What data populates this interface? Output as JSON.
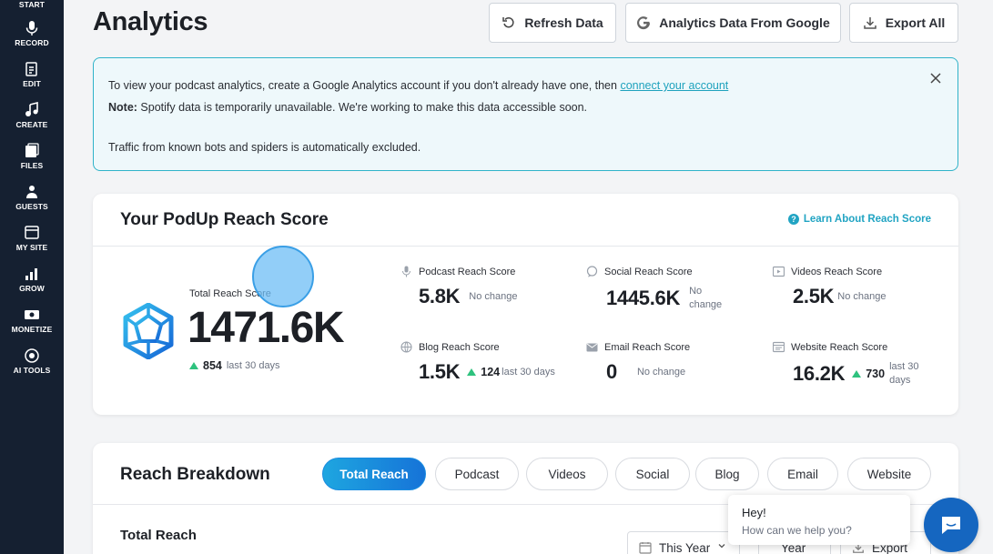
{
  "sidebar": {
    "items": [
      {
        "label": "START",
        "icon": "start-icon"
      },
      {
        "label": "RECORD",
        "icon": "mic-icon"
      },
      {
        "label": "EDIT",
        "icon": "edit-icon"
      },
      {
        "label": "CREATE",
        "icon": "music-note-icon"
      },
      {
        "label": "FILES",
        "icon": "files-icon"
      },
      {
        "label": "GUESTS",
        "icon": "guests-icon"
      },
      {
        "label": "MY SITE",
        "icon": "site-icon"
      },
      {
        "label": "GROW",
        "icon": "bar-chart-icon"
      },
      {
        "label": "MONETIZE",
        "icon": "monetize-icon"
      },
      {
        "label": "AI TOOLS",
        "icon": "ai-tools-icon"
      }
    ]
  },
  "header": {
    "title": "Analytics",
    "refresh_label": "Refresh Data",
    "google_label": "Analytics Data From Google",
    "export_label": "Export All"
  },
  "alert": {
    "line1_prefix": "To view your podcast analytics, create a Google Analytics account if you don't already have one, then ",
    "line1_link": "connect your account",
    "note_label": "Note:",
    "note_text": " Spotify data is temporarily unavailable. We're working to make this data accessible soon.",
    "line3": "Traffic from known bots and spiders is automatically excluded."
  },
  "reach_score": {
    "title": "Your PodUp Reach Score",
    "learn_link": "Learn About Reach Score",
    "total": {
      "label": "Total Reach Score",
      "value": "1471.6K",
      "delta": "854",
      "period": "last 30 days"
    },
    "metrics": [
      {
        "label": "Podcast Reach Score",
        "value": "5.8K",
        "note": "No change",
        "icon": "mic-icon"
      },
      {
        "label": "Social Reach Score",
        "value": "1445.6K",
        "note": "No change",
        "icon": "chat-icon"
      },
      {
        "label": "Videos Reach Score",
        "value": "2.5K",
        "note": "No change",
        "icon": "video-icon"
      },
      {
        "label": "Blog Reach Score",
        "value": "1.5K",
        "delta": "124",
        "note": "last 30 days",
        "icon": "globe-icon"
      },
      {
        "label": "Email Reach Score",
        "value": "0",
        "note": "No change",
        "icon": "email-icon"
      },
      {
        "label": "Website Reach Score",
        "value": "16.2K",
        "delta": "730",
        "note": "last 30 days",
        "icon": "website-icon"
      }
    ]
  },
  "breakdown": {
    "title": "Reach Breakdown",
    "tabs": [
      "Total Reach",
      "Podcast",
      "Videos",
      "Social",
      "Blog",
      "Email",
      "Website"
    ],
    "active_tab": "Total Reach",
    "section_title": "Total Reach",
    "period_select": "This Year",
    "range_select": "Year",
    "export_label": "Export"
  },
  "chat": {
    "greeting": "Hey!",
    "prompt": "How can we help you?"
  },
  "colors": {
    "sidebar_bg": "#152031",
    "accent": "#21a4c3",
    "positive": "#2ec27e",
    "chat": "#1566c0"
  }
}
